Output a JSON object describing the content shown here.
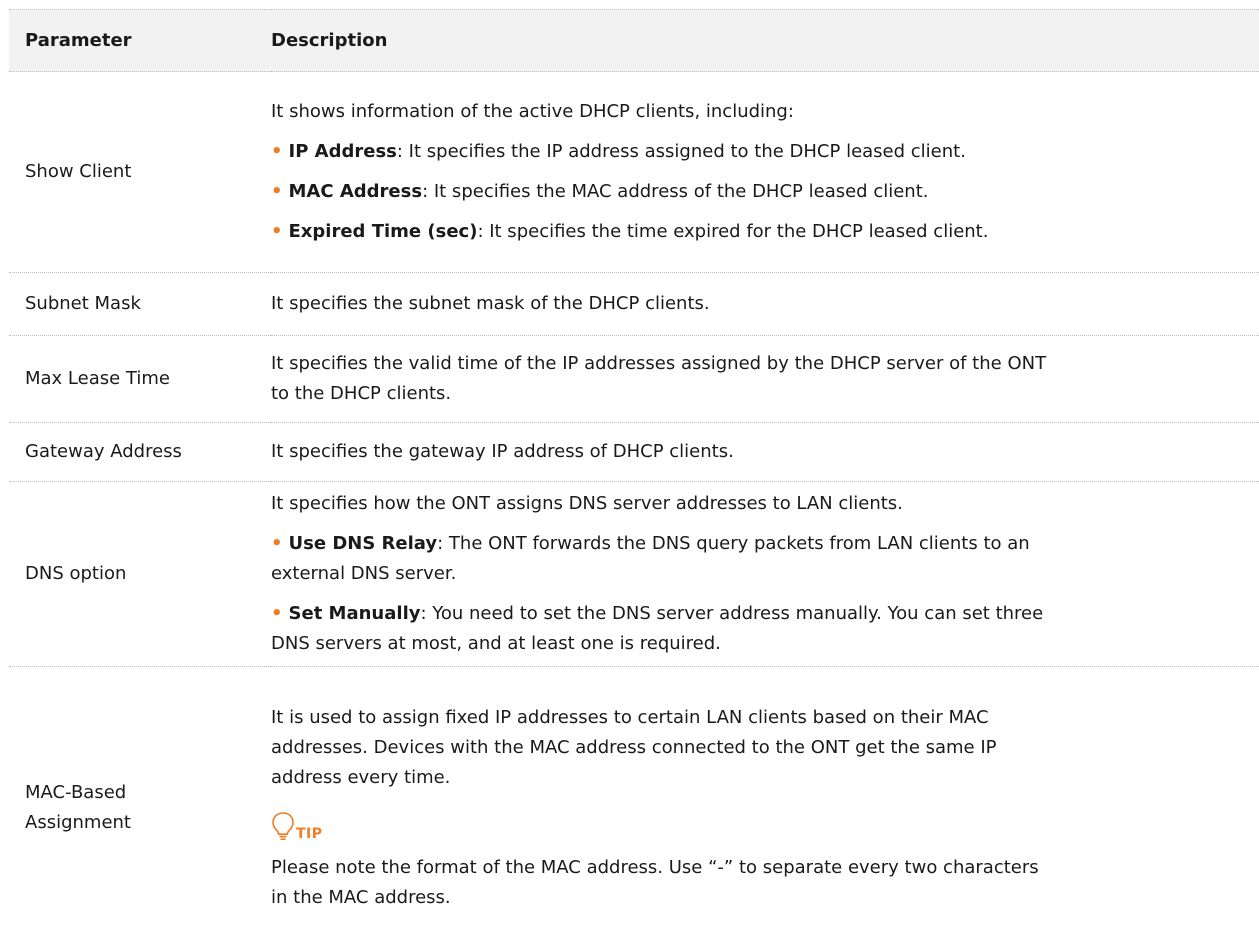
{
  "header": {
    "parameter": "Parameter",
    "description": "Description"
  },
  "rows": {
    "show_client": {
      "param": "Show Client",
      "intro": "It shows information of the active DHCP clients, including:",
      "items": [
        {
          "term": "IP Address",
          "text": ": It specifies the IP address assigned to the DHCP leased client."
        },
        {
          "term": "MAC Address",
          "text": ": It specifies the MAC address of the DHCP leased client."
        },
        {
          "term": "Expired Time (sec)",
          "text": ": It specifies the time expired for the DHCP leased client."
        }
      ]
    },
    "subnet_mask": {
      "param": "Subnet Mask",
      "desc": "It specifies the subnet mask of the DHCP clients."
    },
    "max_lease": {
      "param": "Max Lease Time",
      "desc_line1": "It specifies the valid time of the IP addresses assigned by the DHCP server of the ONT",
      "desc_line2": "to the DHCP clients."
    },
    "gateway": {
      "param": "Gateway Address",
      "desc": "It specifies the gateway IP address of DHCP clients."
    },
    "dns_option": {
      "param": "DNS option",
      "intro": "It specifies how the ONT assigns DNS server addresses to LAN clients.",
      "items": [
        {
          "term": "Use DNS Relay",
          "line1": ": The ONT forwards the DNS query packets from LAN clients to an",
          "line2": "external DNS server."
        },
        {
          "term": "Set Manually",
          "line1": ": You need to set the DNS server address manually. You can set three",
          "line2": "DNS servers at most, and at least one is required."
        }
      ]
    },
    "mac_based": {
      "param_line1": "MAC-Based",
      "param_line2": "Assignment",
      "desc_line1": "It is used to assign fixed IP addresses to certain LAN clients based on their MAC",
      "desc_line2": "addresses. Devices with the MAC address connected to the ONT get the same IP",
      "desc_line3": "address every time.",
      "tip_label": "TIP",
      "tip_line1": "Please note the format of the MAC address. Use “-” to separate every two characters",
      "tip_line2": "in the MAC address."
    }
  },
  "colors": {
    "accent": "#ef7d22",
    "header_bg": "#f2f2f2",
    "border": "#bdbdbd"
  },
  "icons": {
    "bullet": "bullet-dot",
    "tip": "lightbulb-icon"
  }
}
